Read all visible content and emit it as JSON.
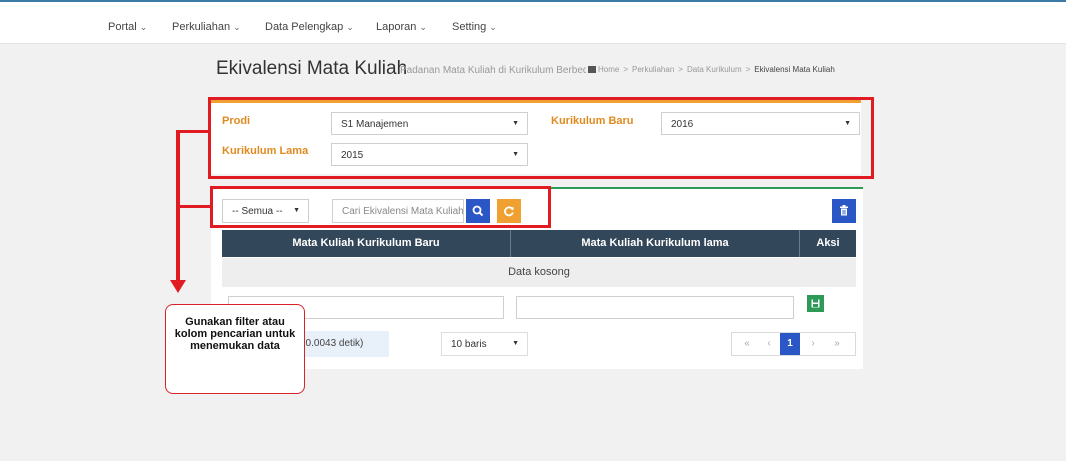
{
  "nav": [
    {
      "label": "Portal"
    },
    {
      "label": "Perkuliahan"
    },
    {
      "label": "Data Pelengkap"
    },
    {
      "label": "Laporan"
    },
    {
      "label": "Setting"
    }
  ],
  "page": {
    "title": "Ekivalensi Mata Kuliah",
    "subtitle": "Padanan Mata Kuliah di Kurikulum Berbeda"
  },
  "breadcrumb": {
    "home": "Home",
    "level1": "Perkuliahan",
    "level2": "Data Kurikulum",
    "current": "Ekivalensi Mata Kuliah"
  },
  "filters": {
    "prodi_label": "Prodi",
    "prodi_value": "S1 Manajemen",
    "kurikulum_baru_label": "Kurikulum Baru",
    "kurikulum_baru_value": "2016",
    "kurikulum_lama_label": "Kurikulum Lama",
    "kurikulum_lama_value": "2015"
  },
  "toolbar": {
    "status_filter": "-- Semua --",
    "search_placeholder": "Cari Ekivalensi Mata Kuliah"
  },
  "table": {
    "columns": [
      "Mata Kuliah Kurikulum Baru",
      "Mata Kuliah Kurikulum lama",
      "Aksi"
    ],
    "empty_text": "Data kosong"
  },
  "footer": {
    "info": ", 0.0043 detik)",
    "rows_per_page": "10 baris",
    "current_page": "1"
  },
  "annotation": {
    "text": "Gunakan filter atau kolom pencarian untuk menemukan data"
  },
  "colors": {
    "accent_orange": "#f0a030",
    "table_header": "#33475a",
    "primary_blue": "#2b56c5",
    "highlight_red": "#e11b22"
  }
}
